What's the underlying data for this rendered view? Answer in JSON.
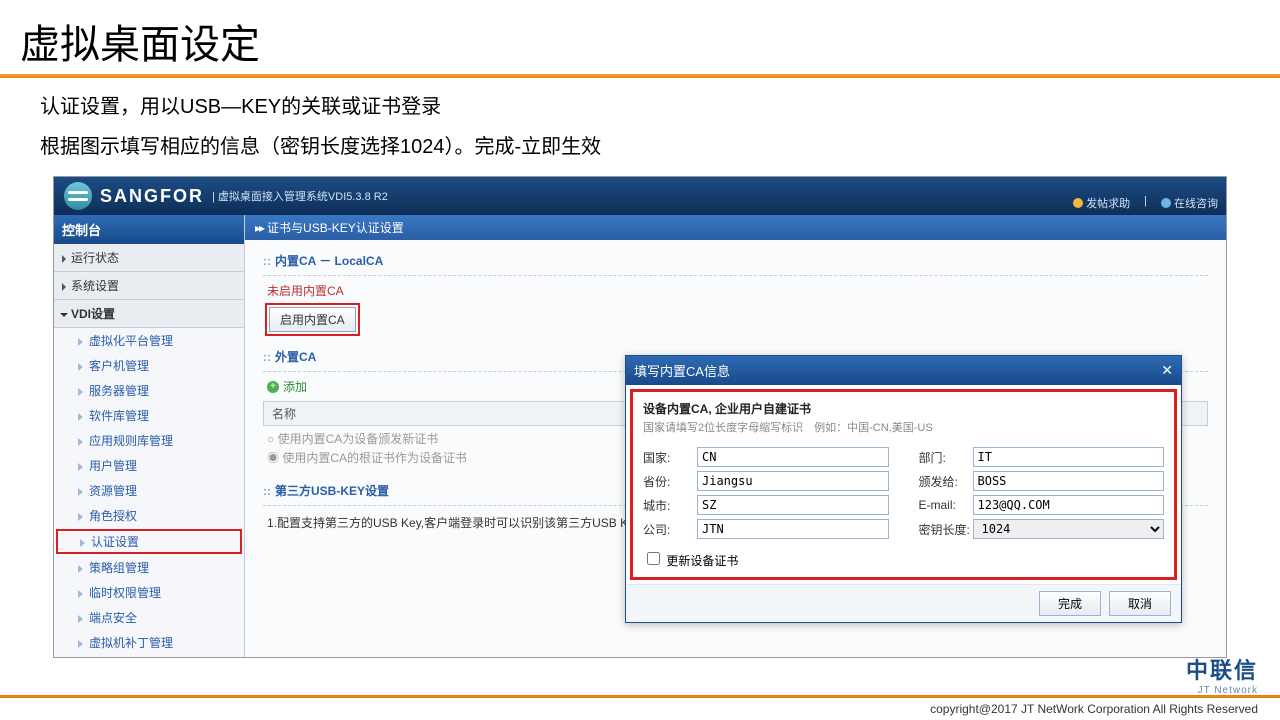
{
  "slide": {
    "title": "虚拟桌面设定",
    "desc1": "认证设置，用以USB—KEY的关联或证书登录",
    "desc2": "根据图示填写相应的信息（密钥长度选择1024）。完成-立即生效"
  },
  "header": {
    "brand": "SANGFOR",
    "subtitle": "| 虚拟桌面接入管理系统VDI5.3.8 R2",
    "help": "发帖求助",
    "consult": "在线咨询"
  },
  "sidebar": {
    "title": "控制台",
    "g1": "运行状态",
    "g2": "系统设置",
    "g3": "VDI设置",
    "items": [
      "虚拟化平台管理",
      "客户机管理",
      "服务器管理",
      "软件库管理",
      "应用规则库管理",
      "用户管理",
      "资源管理",
      "角色授权",
      "认证设置",
      "策略组管理",
      "临时权限管理",
      "端点安全",
      "虚拟机补丁管理"
    ]
  },
  "main": {
    "crumb": "证书与USB-KEY认证设置",
    "sec1": "内置CA － LocalCA",
    "note_red": "未启用内置CA",
    "enable_btn": "启用内置CA",
    "sec2": "外置CA",
    "add": "添加",
    "col_name": "名称",
    "radio1": "使用内置CA为设备颁发新证书",
    "radio2": "使用内置CA的根证书作为设备证书",
    "sec3": "第三方USB-KEY设置",
    "third_note": "1.配置支持第三方的USB Key,客户端登录时可以识别该第三方USB Key,并可以支持USB Key接入和拔出注销."
  },
  "dialog": {
    "title": "填写内置CA信息",
    "subtitle": "设备内置CA, 企业用户自建证书",
    "hint": "国家请填写2位长度字母缩写标识　例如：中国-CN,美国-US",
    "labels": {
      "country": "国家:",
      "province": "省份:",
      "city": "城市:",
      "company": "公司:",
      "dept": "部门:",
      "issued": "颁发给:",
      "email": "E-mail:",
      "keylen": "密钥长度:"
    },
    "values": {
      "country": "CN",
      "province": "Jiangsu",
      "city": "SZ",
      "company": "JTN",
      "dept": "IT",
      "issued": "BOSS",
      "email": "123@QQ.COM",
      "keylen": "1024"
    },
    "update_chk": "更新设备证书",
    "ok": "完成",
    "cancel": "取消"
  },
  "footer": {
    "logo_cn": "中联信",
    "logo_en": "JT Network",
    "copyright": "copyright@2017  JT NetWork Corporation All Rights Reserved"
  }
}
